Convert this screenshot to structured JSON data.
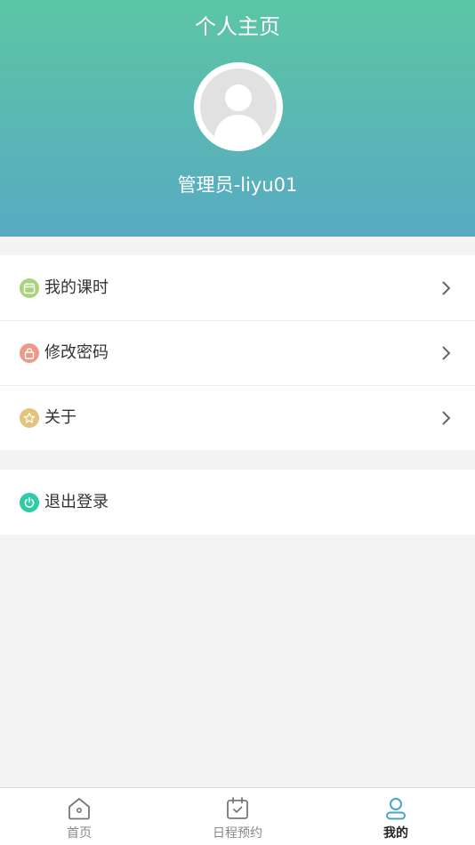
{
  "header": {
    "title": "个人主页",
    "user_name": "管理员-liyu01"
  },
  "menu": {
    "group1": [
      {
        "label": "我的课时",
        "icon": "calendar-icon",
        "color": "#a9d37a"
      },
      {
        "label": "修改密码",
        "icon": "lock-icon",
        "color": "#ec9b86"
      },
      {
        "label": "关于",
        "icon": "star-icon",
        "color": "#e3c47f"
      }
    ],
    "group2": [
      {
        "label": "退出登录",
        "icon": "power-icon",
        "color": "#2fcba5"
      }
    ]
  },
  "tabbar": {
    "items": [
      {
        "label": "首页",
        "icon": "home-icon",
        "active": false
      },
      {
        "label": "日程预约",
        "icon": "schedule-icon",
        "active": false
      },
      {
        "label": "我的",
        "icon": "profile-icon",
        "active": true
      }
    ],
    "active_color": "#4aa3c8"
  }
}
